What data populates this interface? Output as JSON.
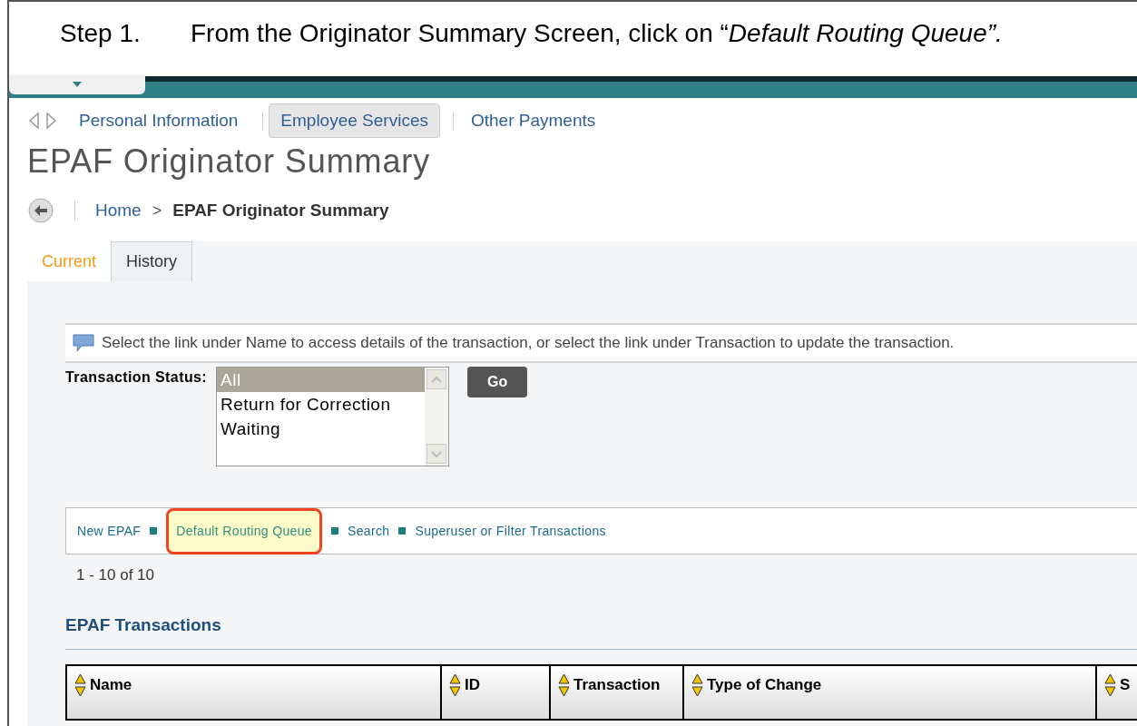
{
  "instruction": {
    "step": "Step 1.",
    "text": "From the Originator Summary Screen, click on “*Default Routing Queue”.*"
  },
  "nav": [
    {
      "label": "Personal Information",
      "selected": false
    },
    {
      "label": "Employee Services",
      "selected": true
    },
    {
      "label": "Other Payments",
      "selected": false
    }
  ],
  "page_title": "EPAF Originator Summary",
  "breadcrumb": {
    "home": "Home",
    "separator": ">",
    "current": "EPAF Originator Summary"
  },
  "tabs": [
    {
      "label": "Current",
      "selected": true
    },
    {
      "label": "History",
      "selected": false
    }
  ],
  "info_message": "Select the link under Name to access details of the transaction, or select the link under Transaction to update the transaction.",
  "status_filter": {
    "label": "Transaction Status:",
    "options": [
      {
        "label": "All",
        "selected": true
      },
      {
        "label": "Return for Correction",
        "selected": false
      },
      {
        "label": "Waiting",
        "selected": false
      }
    ],
    "button": "Go"
  },
  "links": [
    {
      "label": "New EPAF",
      "highlighted": false
    },
    {
      "label": "Default Routing Queue",
      "highlighted": true
    },
    {
      "label": "Search",
      "highlighted": false
    },
    {
      "label": "Superuser or Filter Transactions",
      "highlighted": false
    }
  ],
  "record_count": "1 - 10 of 10",
  "section_title": "EPAF Transactions",
  "table": {
    "columns": [
      "Name",
      "ID",
      "Transaction",
      "Type of Change",
      "S"
    ]
  }
}
